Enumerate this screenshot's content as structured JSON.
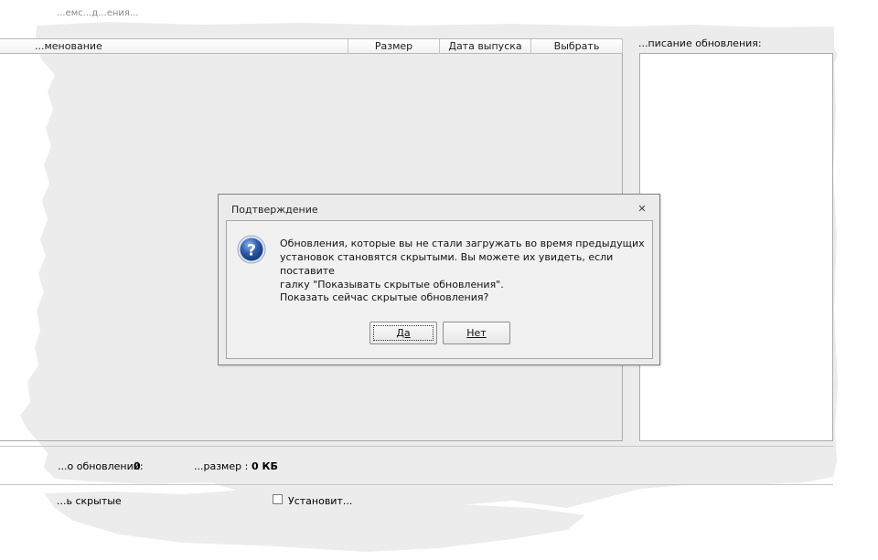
{
  "window": {
    "top_fragment": "...емс...д...ения..."
  },
  "list": {
    "columns": {
      "name": "...менование",
      "size": "Размер",
      "release_date": "Дата выпуска",
      "select": "Выбрать"
    }
  },
  "description": {
    "label": "...писание обновления:"
  },
  "status": {
    "count_label": "...о обновлений:",
    "count_value": "0",
    "size_label": "...размер :",
    "size_value": "0 КБ"
  },
  "options": {
    "show_hidden_label": "...ь скрытые",
    "install_label": "Установит..."
  },
  "dialog": {
    "title": "Подтверждение",
    "close_glyph": "✕",
    "message_lines": [
      "Обновления, которые вы не стали загружать во время предыдущих",
      "установок становятся скрытыми. Вы можете их увидеть, если поставите",
      "галку \"Показывать скрытые обновления\"."
    ],
    "question": "Показать сейчас скрытые обновления?",
    "yes_label": "Да",
    "no_label": "Нет",
    "icon": "question-icon",
    "accent_color": "#2d5aa8"
  }
}
